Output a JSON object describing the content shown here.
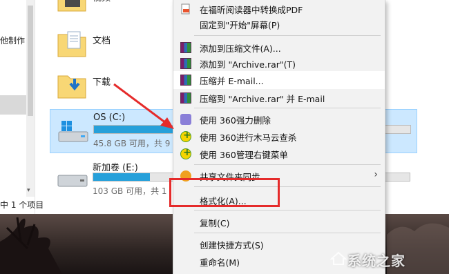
{
  "explorer": {
    "sidebar": {
      "labels": [
        "他制作"
      ]
    },
    "folders": [
      {
        "name": "视频",
        "icon": "video-folder-icon"
      },
      {
        "name": "文档",
        "icon": "documents-folder-icon"
      },
      {
        "name": "下载",
        "icon": "downloads-folder-icon"
      }
    ],
    "drives": [
      {
        "name": "OS (C:)",
        "info": "45.8 GB 可用，共 9",
        "used_fraction": 0.82,
        "icon": "windows-drive-icon"
      },
      {
        "name": "新加卷 (E:)",
        "info": "103 GB 可用，共 1",
        "used_fraction": 0.18,
        "icon": "drive-icon"
      }
    ],
    "status": "中 1 个项目"
  },
  "context_menu": {
    "items": [
      {
        "label": "在福昕阅读器中转换成PDF",
        "icon": "pdf-icon"
      },
      {
        "label": "固定到\"开始\"屏幕(P)",
        "icon": ""
      },
      {
        "label": "添加到压缩文件(A)...",
        "icon": "winrar-icon"
      },
      {
        "label": "添加到 \"Archive.rar\"(T)",
        "icon": "winrar-icon"
      },
      {
        "label": "压缩并 E-mail...",
        "icon": "winrar-icon"
      },
      {
        "label": "压缩到 \"Archive.rar\" 并 E-mail",
        "icon": "winrar-icon"
      },
      {
        "label": "使用 360强力删除",
        "icon": "shredder-icon"
      },
      {
        "label": "使用 360进行木马云查杀",
        "icon": "360-icon"
      },
      {
        "label": "使用 360管理右键菜单",
        "icon": "360-icon"
      },
      {
        "label": "共享文件夹同步",
        "icon": "share-icon",
        "submenu": true
      },
      {
        "label": "格式化(A)...",
        "icon": ""
      },
      {
        "label": "复制(C)",
        "icon": ""
      },
      {
        "label": "创建快捷方式(S)",
        "icon": ""
      },
      {
        "label": "重命名(M)",
        "icon": ""
      }
    ]
  },
  "watermark": {
    "text": "系统之家"
  },
  "colors": {
    "highlight_box": "#e52b2b",
    "arrow": "#e52b2b",
    "drive_fill": "#26a0da",
    "selection": "#cce8ff"
  }
}
